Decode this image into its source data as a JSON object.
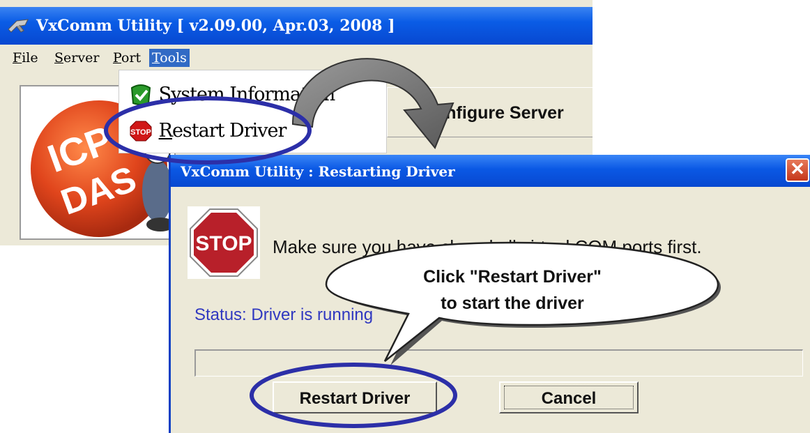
{
  "main_window": {
    "title": "VxComm Utility [ v2.09.00, Apr.03, 2008 ]",
    "menus": [
      {
        "label": "File",
        "ul": "F",
        "rest": "ile"
      },
      {
        "label": "Server",
        "ul": "S",
        "rest": "erver"
      },
      {
        "label": "Port",
        "ul": "P",
        "rest": "ort"
      },
      {
        "label": "Tools",
        "ul": "T",
        "rest": "ools"
      }
    ],
    "configure_button": "onfigure Server"
  },
  "tools_menu": {
    "items": [
      {
        "label": "System Information"
      },
      {
        "label": "Restart Driver",
        "ul": "R",
        "rest": "estart Driver"
      }
    ]
  },
  "dialog": {
    "title": "VxComm Utility : Restarting Driver",
    "close_glyph": "✕",
    "stop_sign_text": "STOP",
    "message": "Make sure you have closed all virtual COM ports first.",
    "status": "Status: Driver is running",
    "restart_button": "Restart Driver",
    "cancel_button": "Cancel"
  },
  "annotation": {
    "callout_line1": "Click \"Restart Driver\"",
    "callout_line2": "to start the driver",
    "highlight_color": "#2c2fa8"
  },
  "colors": {
    "titlebar_blue": "#0a58e4",
    "status_text": "#3038c0",
    "window_bg": "#ece9d8"
  }
}
